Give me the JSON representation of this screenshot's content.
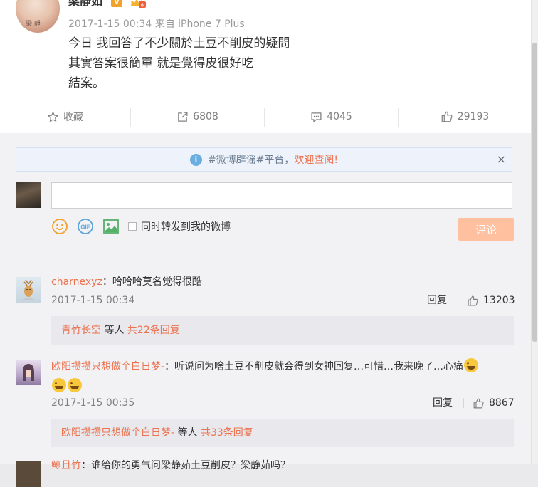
{
  "post": {
    "author": "梁静如",
    "vip_badge": "V",
    "meta_time": "2017-1-15 00:34",
    "meta_source": "来自 iPhone 7 Plus",
    "text_lines": [
      "今日 我回答了不少關於土豆不削皮的疑問",
      "其實答案很簡單 就是覺得皮很好吃",
      "結案。"
    ]
  },
  "actions": {
    "favorite": "收藏",
    "repost": "6808",
    "comment": "4045",
    "like": "29193"
  },
  "notice": {
    "tag": "#微博辟谣#平台，",
    "link": "欢迎查阅!",
    "close": "×"
  },
  "composer": {
    "input_value": "",
    "repost_label": "同时转发到我的微博",
    "submit_label": "评论"
  },
  "comments": [
    {
      "user": "charnexyz",
      "text": "：哈哈哈莫名觉得很酷",
      "time": "2017-1-15 00:34",
      "reply_label": "回复",
      "likes": "13203",
      "sub_user": "青竹长空",
      "sub_mid": " 等人 ",
      "sub_more": "共22条回复"
    },
    {
      "user": "欧阳攒攒只想做个白日梦-",
      "text": "：听说问为啥土豆不削皮就会得到女神回复…可惜…我来晚了…心痛",
      "time": "2017-1-15 00:35",
      "reply_label": "回复",
      "likes": "8867",
      "sub_user": "欧阳攒攒只想做个白日梦-",
      "sub_mid": " 等人 ",
      "sub_more": "共33条回复"
    }
  ],
  "partial_comment": {
    "user": "鲸且竹",
    "text": "：谁给你的勇气问梁静茹土豆削皮？梁静茹吗？"
  },
  "colors": {
    "accent": "#eb7350",
    "submit_disabled": "#ffc09f",
    "notice_bg": "#eef3fb",
    "comment_area_bg": "#f2f2f5"
  },
  "icons": {
    "favorite": "star-icon",
    "repost": "repost-icon",
    "comment": "comment-icon",
    "like": "thumbs-up-icon",
    "notice": "info-icon",
    "emoticon": "smiley-icon",
    "gif": "gif-icon",
    "image": "image-icon"
  }
}
